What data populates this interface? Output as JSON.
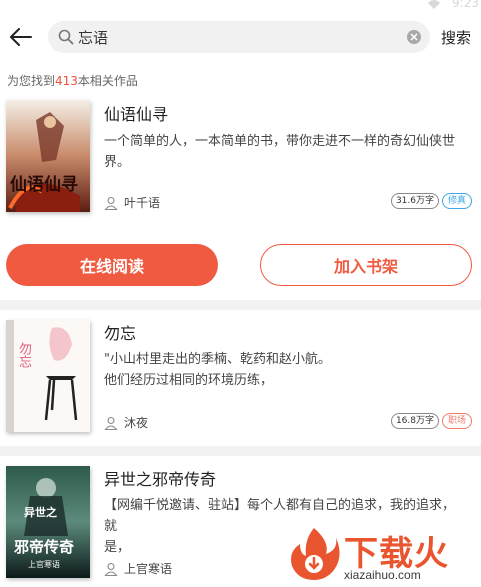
{
  "status_bar": {
    "time": "9:23"
  },
  "header": {
    "search_value": "忘语",
    "search_button": "搜索"
  },
  "result_summary": {
    "prefix": "为您找到",
    "count": "413",
    "suffix": "本相关作品"
  },
  "books": [
    {
      "title": "仙语仙寻",
      "description": "一个简单的人，一本简单的书，带你走进不一样的奇幻仙侠世界。",
      "author": "叶千语",
      "word_count": "31.6万字",
      "tag": "修真",
      "tag_color": "#3da8e6",
      "cover_text": "仙语仙寻"
    },
    {
      "title": "勿忘",
      "description_lines": [
        "\"小山村里走出的季楠、乾药和赵小航。",
        "他们经历过相同的环境历练，"
      ],
      "author": "沐夜",
      "word_count": "16.8万字",
      "tag": "职场",
      "tag_color": "#f27a6a",
      "cover_text": "勿忘"
    },
    {
      "title": "异世之邪帝传奇",
      "description_lines": [
        "【网编千悦邀请、驻站】每个人都有自己的追求，我的追求，就",
        "是，"
      ],
      "author": "上官寒语",
      "cover_text_top": "异世之",
      "cover_text_main": "邪帝传奇",
      "cover_text_sub": "上官寒语"
    }
  ],
  "actions": {
    "read_online": "在线阅读",
    "add_to_shelf": "加入书架"
  },
  "watermark": {
    "brand": "下载火",
    "url": "xiazaihuo.com"
  },
  "colors": {
    "accent": "#f05a40",
    "count_highlight": "#f1503c"
  }
}
